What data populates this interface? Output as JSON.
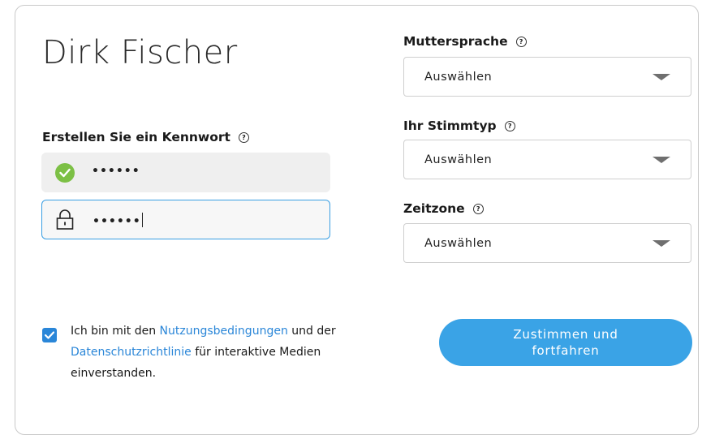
{
  "user": {
    "name": "Dirk Fischer"
  },
  "password": {
    "label": "Erstellen Sie ein Kennwort",
    "help": "?",
    "field1_value": "••••••",
    "field2_value": "••••••"
  },
  "fields": [
    {
      "label": "Muttersprache",
      "help": "?",
      "value": "Auswählen"
    },
    {
      "label": "Ihr Stimmtyp",
      "help": "?",
      "value": "Auswählen"
    },
    {
      "label": "Zeitzone",
      "help": "?",
      "value": "Auswählen"
    }
  ],
  "terms": {
    "checked": true,
    "text_1": "Ich bin mit den ",
    "link_1": "Nutzungsbedingungen",
    "text_2": " und der ",
    "link_2": "Datenschutzrichtlinie",
    "text_3": " für interaktive Medien einverstanden."
  },
  "cta": {
    "line1": "Zustimmen und",
    "line2": "fortfahren"
  },
  "colors": {
    "accent": "#3aa3e6",
    "link": "#2a86d8",
    "success": "#7cc045",
    "focus_border": "#3a9fe3"
  }
}
